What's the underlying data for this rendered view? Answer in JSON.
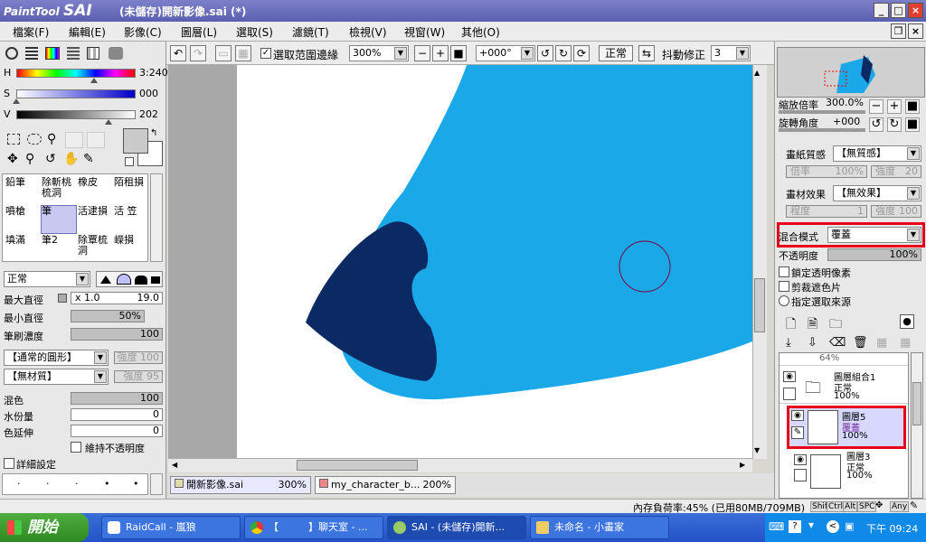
{
  "window": {
    "app_logo": "PaintTool",
    "app_logo_bold": "SAI",
    "title": "(未儲存)開新影像.sai (*)",
    "min_label": "_",
    "max_label": "□",
    "close_label": "×"
  },
  "doc_window_buttons": {
    "restore": "❐",
    "close": "×"
  },
  "menu": [
    "檔案(F)",
    "編輯(E)",
    "影像(C)",
    "圖層(L)",
    "選取(S)",
    "濾鏡(T)",
    "檢視(V)",
    "視窗(W)",
    "其他(O)"
  ],
  "color_panel": {
    "h_label": "H",
    "h_value": "3:240",
    "s_label": "S",
    "s_value": "000",
    "v_label": "V",
    "v_value": "202"
  },
  "tools": [
    "鉛筆",
    "除斬桃梳洞",
    "橡皮",
    "陌租損",
    "噴槍",
    "筆",
    "活逮損",
    "活 笠",
    "填滿",
    "筆2",
    "除覃梳洞",
    "嶸損"
  ],
  "brush_settings": {
    "blend": "正常",
    "max_size_label": "最大直徑",
    "max_size_mult": "x 1.0",
    "max_size_value": "19.0",
    "min_size_label": "最小直徑",
    "min_size_value": "50%",
    "density_label": "筆刷濃度",
    "density_value": "100",
    "shape": "【通常的圓形】",
    "shape_strength": "強度 100",
    "texture": "【無材質】",
    "texture_strength": "強度 95",
    "mix_label": "混色",
    "mix_value": "100",
    "water_label": "水份量",
    "water_value": "0",
    "stretch_label": "色延伸",
    "stretch_value": "0",
    "keep_opacity": "維持不透明度",
    "detail": "詳細設定",
    "size_dots": [
      "·",
      "·",
      "·",
      "•",
      "•"
    ]
  },
  "toolbar": {
    "selection_edge": "選取范圍邊緣",
    "zoom": "300%",
    "angle": "+000°",
    "mode": "正常",
    "stabilizer_label": "抖動修正",
    "stabilizer_value": "3"
  },
  "navigator": {
    "zoom_label": "縮放倍率",
    "zoom_value": "300.0%",
    "rotate_label": "旋轉角度",
    "rotate_value": "+000"
  },
  "layer_props": {
    "paper_label": "畫紙質感",
    "paper_value": "【無質感】",
    "paper_scale": "倍率",
    "paper_scale_val": "100%",
    "paper_strength": "強度",
    "paper_strength_val": "20",
    "effect_label": "畫材效果",
    "effect_value": "【無效果】",
    "effect_degree": "程度",
    "effect_degree_val": "1",
    "effect_strength": "強度",
    "effect_strength_val": "100",
    "blend_label": "混合模式",
    "blend_value": "覆蓋",
    "opacity_label": "不透明度",
    "opacity_value": "100%",
    "lock_alpha": "鎖定透明像素",
    "clipping": "剪裁遮色片",
    "selection_source": "指定選取來源"
  },
  "layers": [
    {
      "name": "",
      "mode": "",
      "opacity": "64%"
    },
    {
      "name": "圖層組合1",
      "mode": "正常",
      "opacity": "100%"
    },
    {
      "name": "圖層5",
      "mode": "覆蓋",
      "opacity": "100%"
    },
    {
      "name": "圖層3",
      "mode": "正常",
      "opacity": "100%"
    }
  ],
  "doc_tabs": [
    {
      "name": "開新影像.sai",
      "zoom": "300%"
    },
    {
      "name": "my_character_b...",
      "zoom": "200%"
    }
  ],
  "status": {
    "memory": "內存負荷率:45% (已用80MB/709MB)",
    "keys": [
      "Shift",
      "Ctrl",
      "Alt",
      "SPC",
      "Any"
    ]
  },
  "taskbar": {
    "start": "開始",
    "tasks": [
      "RaidCall - 嵐狼",
      "【　　　】聊天室 - ...",
      "SAI - (未儲存)開新...",
      "未命名 - 小畫家"
    ],
    "clock": "下午 09:24"
  },
  "colors": {
    "accent": "#7d80c9",
    "canvas_light_blue": "#1aa8e8",
    "canvas_dark_blue": "#0b2a63",
    "highlight_red": "#e8001a"
  }
}
